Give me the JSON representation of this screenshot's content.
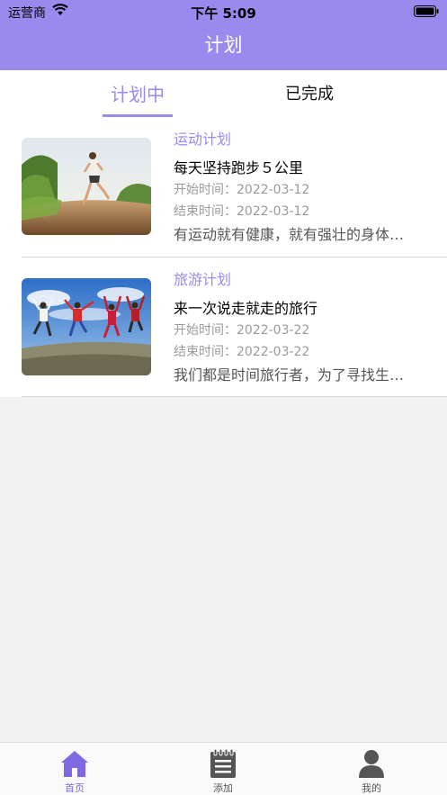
{
  "status": {
    "carrier": "运营商",
    "time": "下午 5:09"
  },
  "nav": {
    "title": "计划"
  },
  "tabs": {
    "active": "计划中",
    "done": "已完成"
  },
  "plans": [
    {
      "category": "运动计划",
      "title": "每天坚持跑步５公里",
      "start": "开始时间：2022-03-12",
      "end": "结束时间：2022-03-12",
      "desc": "有运动就有健康，就有强壮的身体…"
    },
    {
      "category": "旅游计划",
      "title": "来一次说走就走的旅行",
      "start": "开始时间：2022-03-22",
      "end": "结束时间：2022-03-22",
      "desc": "我们都是时间旅行者，为了寻找生…"
    }
  ],
  "tabbar": {
    "home": "首页",
    "add": "添加",
    "me": "我的"
  },
  "colors": {
    "accent": "#9b8aee",
    "tab_active_icon": "#7f68e0"
  },
  "icons": [
    "wifi-icon",
    "battery-icon",
    "home-icon",
    "notepad-icon",
    "user-icon"
  ]
}
